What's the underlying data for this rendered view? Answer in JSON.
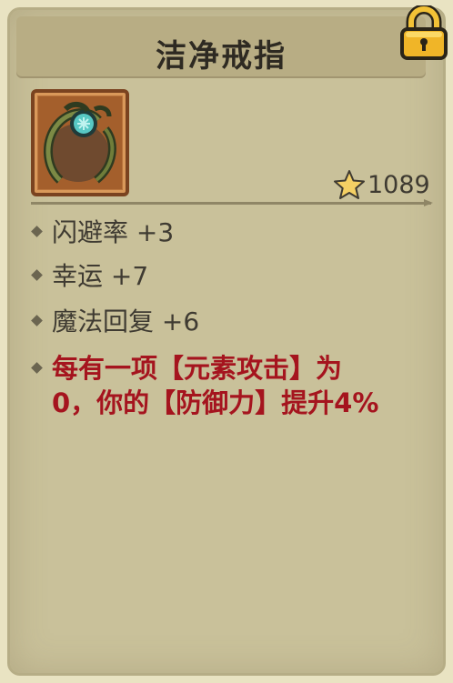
{
  "item": {
    "name": "洁净戒指",
    "icon": "vine-ring-icon",
    "score": "1089"
  },
  "stats": [
    "闪避率 +3",
    "幸运 +7",
    "魔法回复 +6"
  ],
  "effect": {
    "line1": "每有一项【元素攻击】为",
    "line2": "0，你的【防御力】提升4%"
  },
  "colors": {
    "panel": "#c9c19a",
    "title_band": "#b8ad84",
    "effect_text": "#a5141e",
    "lock": "#f0b528"
  }
}
